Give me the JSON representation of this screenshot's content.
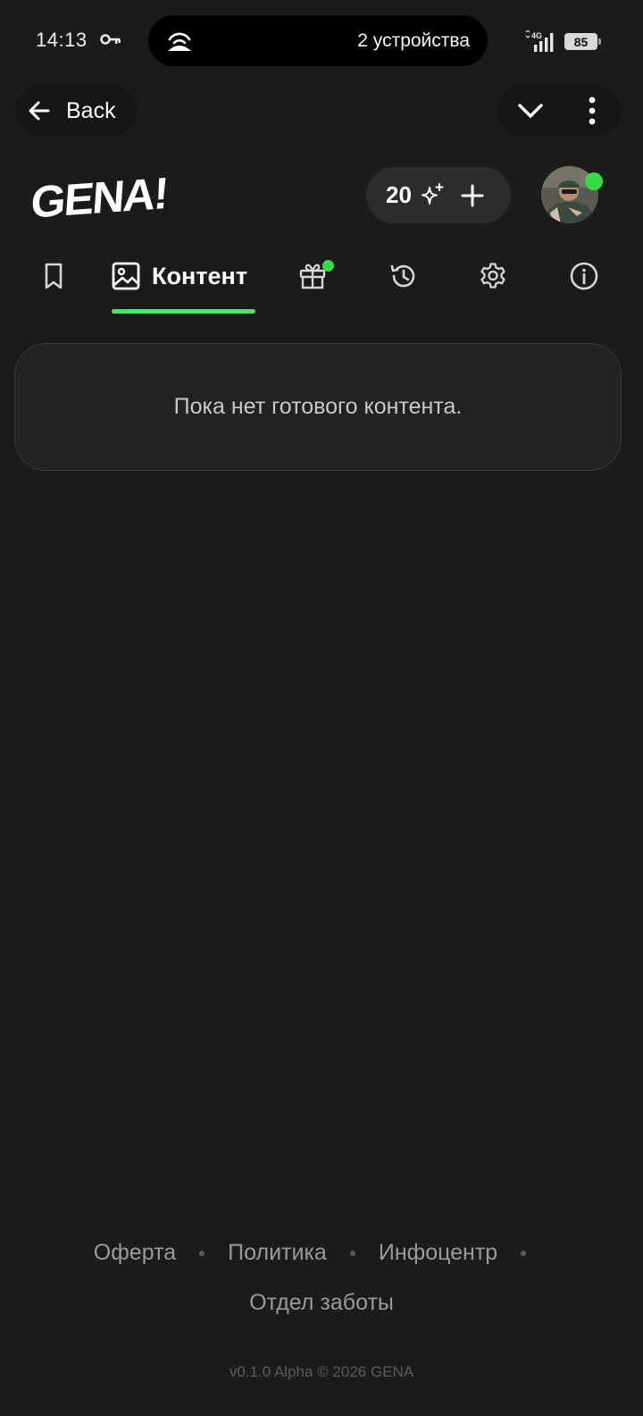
{
  "status_bar": {
    "time": "14:13",
    "island_text": "2 устройства",
    "network": "4G",
    "battery": "85"
  },
  "nav": {
    "back_label": "Back"
  },
  "header": {
    "logo_text": "GENA!",
    "credits_count": "20"
  },
  "tabs": {
    "active_label": "Контент",
    "items": [
      "bookmark-icon",
      "image-icon",
      "gift-icon",
      "history-icon",
      "gear-icon",
      "info-icon"
    ]
  },
  "main": {
    "empty_message": "Пока нет готового контента."
  },
  "footer": {
    "links": [
      "Оферта",
      "Политика",
      "Инфоцентр",
      "Отдел заботы"
    ],
    "version": "v0.1.0 Alpha © 2026 GENA"
  },
  "colors": {
    "background": "#1b1b1b",
    "accent": "#4ee06a",
    "online": "#35dc44",
    "card": "#222222"
  }
}
